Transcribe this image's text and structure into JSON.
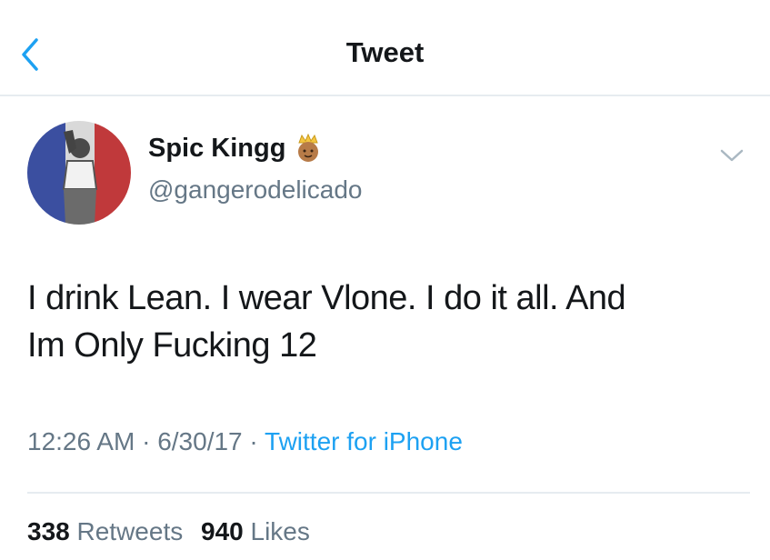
{
  "header": {
    "title": "Tweet",
    "back_icon": "chevron-left-icon",
    "accent_color": "#1da1f2"
  },
  "author": {
    "display_name": "Spic Kingg",
    "name_emoji": "prince-emoji-icon",
    "handle": "@gangerodelicado",
    "avatar": "profile-avatar"
  },
  "tweet": {
    "lines": [
      "I drink Lean. I wear Vlone. I do it all. And",
      "Im Only Fucking 12"
    ],
    "time": "12:26 AM",
    "date": "6/30/17",
    "source": "Twitter for iPhone",
    "separator": "·"
  },
  "stats": {
    "retweets_count": "338",
    "retweets_label": "Retweets",
    "likes_count": "940",
    "likes_label": "Likes"
  }
}
